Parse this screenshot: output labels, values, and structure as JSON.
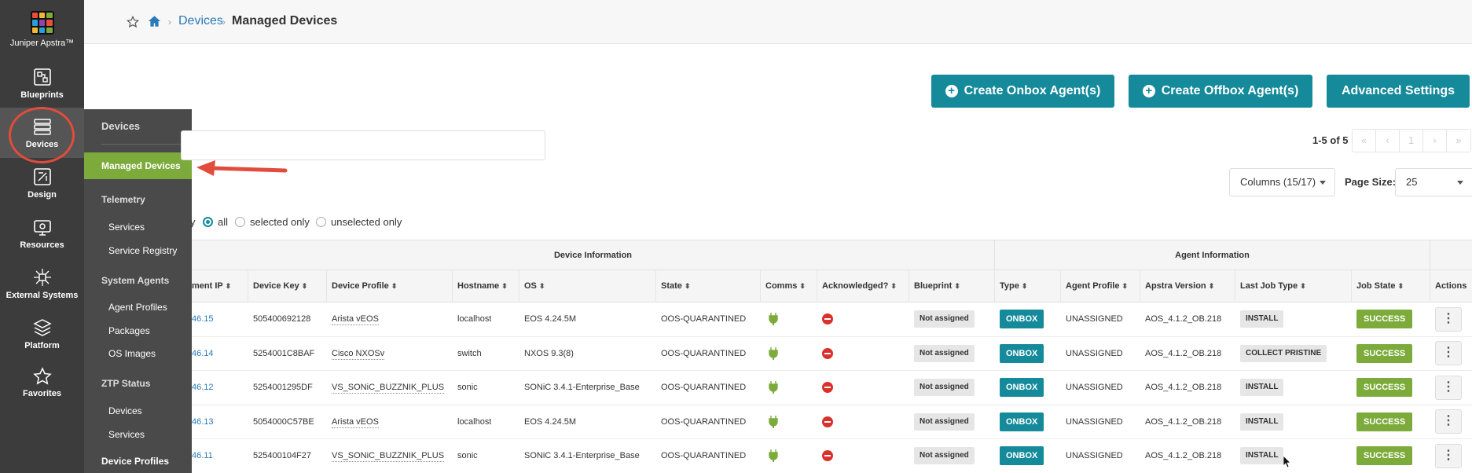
{
  "app": {
    "logo_text": "Juniper Apstra™"
  },
  "leftnav": {
    "items": [
      {
        "label": "Blueprints",
        "icon": "blueprints-icon"
      },
      {
        "label": "Devices",
        "icon": "devices-icon"
      },
      {
        "label": "Design",
        "icon": "design-icon"
      },
      {
        "label": "Resources",
        "icon": "resources-icon"
      },
      {
        "label": "External Systems",
        "icon": "external-systems-icon"
      },
      {
        "label": "Platform",
        "icon": "platform-icon"
      },
      {
        "label": "Favorites",
        "icon": "star-icon"
      }
    ]
  },
  "flyout": {
    "title": "Devices",
    "active": "Managed Devices",
    "telemetry": "Telemetry",
    "telemetry_items": [
      "Services",
      "Service Registry"
    ],
    "system_agents": "System Agents",
    "system_agents_items": [
      "Agent Profiles",
      "Packages",
      "OS Images"
    ],
    "ztp": "ZTP Status",
    "ztp_items": [
      "Devices",
      "Services"
    ],
    "device_profiles": "Device Profiles"
  },
  "breadcrumb": {
    "link": "Devices",
    "current": "Managed Devices"
  },
  "toolbar": {
    "create_onbox": "Create Onbox Agent(s)",
    "create_offbox": "Create Offbox Agent(s)",
    "advanced": "Advanced Settings"
  },
  "pagination": {
    "summary": "1-5 of 5",
    "page": "1",
    "columns_select": "Columns (15/17)",
    "page_size_label": "Page Size:",
    "page_size": "25"
  },
  "filter": {
    "prefix": "y",
    "options": [
      "all",
      "selected only",
      "unselected only"
    ],
    "selected": "all"
  },
  "table": {
    "groups": {
      "device_info": "Device Information",
      "agent_info": "Agent Information"
    },
    "headers": [
      "ment IP",
      "Device Key",
      "Device Profile",
      "Hostname",
      "OS",
      "State",
      "Comms",
      "Acknowledged?",
      "Blueprint",
      "Type",
      "Agent Profile",
      "Apstra Version",
      "Last Job Type",
      "Job State",
      "Actions"
    ],
    "rows": [
      {
        "ip": "46.15",
        "key": "505400692128",
        "profile": "Arista vEOS",
        "hostname": "localhost",
        "os": "EOS 4.24.5M",
        "state": "OOS-QUARANTINED",
        "blueprint": "Not assigned",
        "type": "ONBOX",
        "agent_profile": "UNASSIGNED",
        "version": "AOS_4.1.2_OB.218",
        "job_type": "INSTALL",
        "job_state": "SUCCESS"
      },
      {
        "ip": "46.14",
        "key": "5254001C8BAF",
        "profile": "Cisco NXOSv",
        "hostname": "switch",
        "os": "NXOS 9.3(8)",
        "state": "OOS-QUARANTINED",
        "blueprint": "Not assigned",
        "type": "ONBOX",
        "agent_profile": "UNASSIGNED",
        "version": "AOS_4.1.2_OB.218",
        "job_type": "COLLECT PRISTINE",
        "job_state": "SUCCESS"
      },
      {
        "ip": "46.12",
        "key": "5254001295DF",
        "profile": "VS_SONiC_BUZZNIK_PLUS",
        "hostname": "sonic",
        "os": "SONiC 3.4.1-Enterprise_Base",
        "state": "OOS-QUARANTINED",
        "blueprint": "Not assigned",
        "type": "ONBOX",
        "agent_profile": "UNASSIGNED",
        "version": "AOS_4.1.2_OB.218",
        "job_type": "INSTALL",
        "job_state": "SUCCESS"
      },
      {
        "ip": "46.13",
        "key": "5054000C57BE",
        "profile": "Arista vEOS",
        "hostname": "localhost",
        "os": "EOS 4.24.5M",
        "state": "OOS-QUARANTINED",
        "blueprint": "Not assigned",
        "type": "ONBOX",
        "agent_profile": "UNASSIGNED",
        "version": "AOS_4.1.2_OB.218",
        "job_type": "INSTALL",
        "job_state": "SUCCESS"
      },
      {
        "ip": "46.11",
        "key": "525400104F27",
        "profile": "VS_SONiC_BUZZNIK_PLUS",
        "hostname": "sonic",
        "os": "SONiC 3.4.1-Enterprise_Base",
        "state": "OOS-QUARANTINED",
        "blueprint": "Not assigned",
        "type": "ONBOX",
        "agent_profile": "UNASSIGNED",
        "version": "AOS_4.1.2_OB.218",
        "job_type": "INSTALL",
        "job_state": "SUCCESS"
      }
    ]
  },
  "colors": {
    "teal": "#158a9a",
    "green": "#7cab3b",
    "nav_bg": "#3c3c3c",
    "flyout_bg": "#4a4a4a",
    "highlight": "#e24c3c"
  }
}
